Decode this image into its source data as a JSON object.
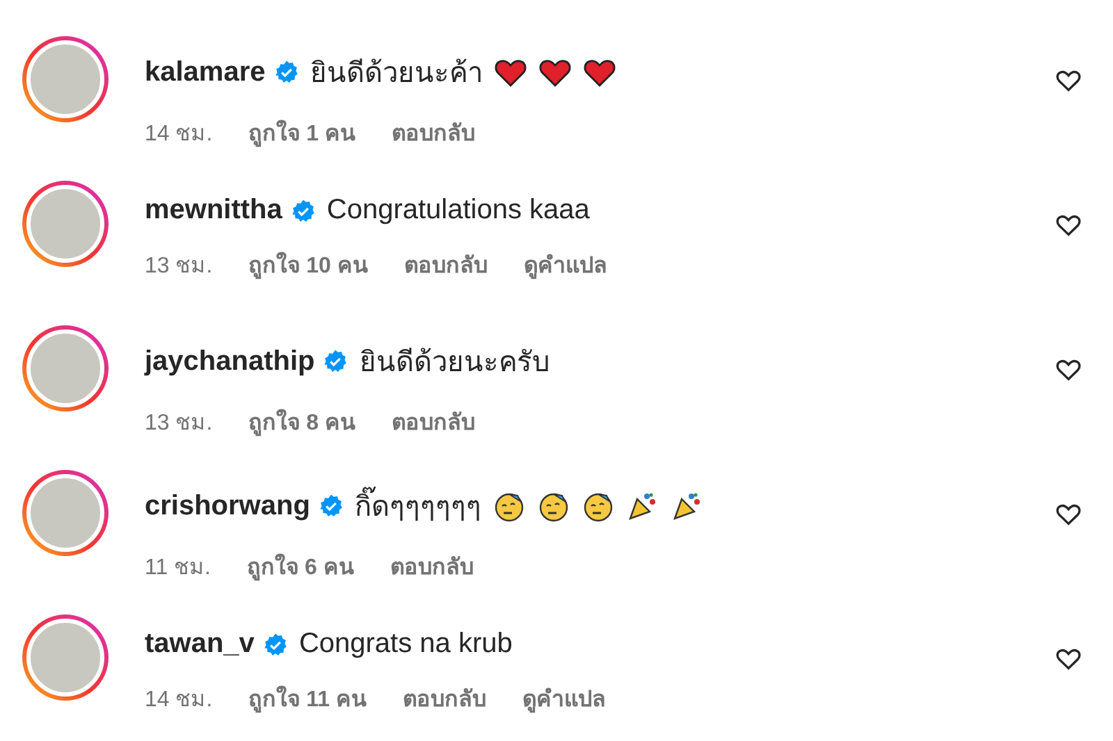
{
  "comments": [
    {
      "username": "kalamare",
      "verified": true,
      "text": "ยินดีด้วยนะค้า",
      "emojis": [
        {
          "kind": "heart"
        },
        {
          "kind": "heart"
        },
        {
          "kind": "heart"
        }
      ],
      "time": "14 ชม.",
      "likes": "ถูกใจ 1 คน",
      "reply": "ตอบกลับ"
    },
    {
      "username": "mewnittha",
      "verified": true,
      "text": "Congratulations kaaa",
      "time": "13 ชม.",
      "likes": "ถูกใจ 10 คน",
      "reply": "ตอบกลับ",
      "translate": "ดูคำแปล"
    },
    {
      "username": "jaychanathip",
      "verified": true,
      "text": "ยินดีด้วยนะครับ",
      "time": "13 ชม.",
      "likes": "ถูกใจ 8 คน",
      "reply": "ตอบกลับ"
    },
    {
      "username": "crishorwang",
      "verified": true,
      "text": "กิ๊ดๆๆๆๆๆๆ",
      "emojis": [
        {
          "kind": "party-face"
        },
        {
          "kind": "party-face"
        },
        {
          "kind": "party-face"
        },
        {
          "kind": "party-popper"
        },
        {
          "kind": "party-popper"
        }
      ],
      "time": "11 ชม.",
      "likes": "ถูกใจ 6 คน",
      "reply": "ตอบกลับ"
    },
    {
      "username": "tawan_v",
      "verified": true,
      "text": "Congrats na krub",
      "time": "14 ชม.",
      "likes": "ถูกใจ 11 คน",
      "reply": "ตอบกลับ",
      "translate": "ดูคำแปล"
    }
  ]
}
